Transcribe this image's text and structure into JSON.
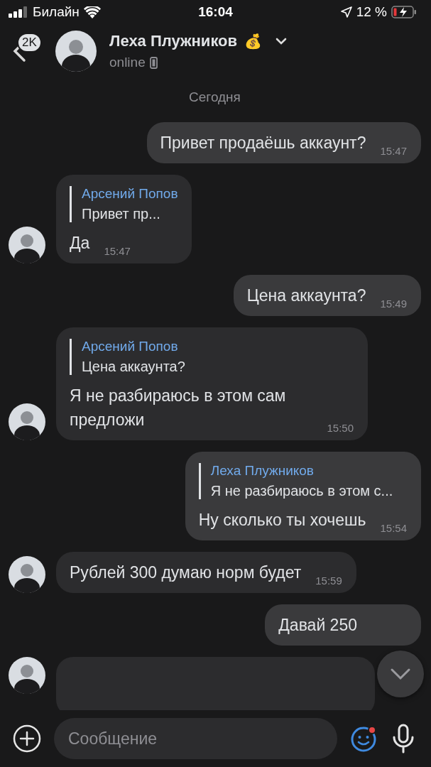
{
  "status_bar": {
    "carrier": "Билайн",
    "time": "16:04",
    "battery": "12 %"
  },
  "header": {
    "back_badge": "2K",
    "name": "Леха Плужников",
    "emoji": "💰",
    "status": "online"
  },
  "date_divider": "Сегодня",
  "messages": [
    {
      "kind": "out",
      "text": "Привет продаёшь аккаунт?",
      "time": "15:47"
    },
    {
      "kind": "in",
      "reply": {
        "author": "Арсений Попов",
        "text": "Привет пр..."
      },
      "text": "Да",
      "time": "15:47"
    },
    {
      "kind": "out",
      "text": "Цена аккаунта?",
      "time": "15:49"
    },
    {
      "kind": "in",
      "reply": {
        "author": "Арсений Попов",
        "text": "Цена аккаунта?"
      },
      "text": "Я не разбираюсь в этом сам предложи",
      "time": "15:50"
    },
    {
      "kind": "out",
      "reply": {
        "author": "Леха Плужников",
        "text": "Я не разбираюсь в этом с..."
      },
      "text": "Ну сколько ты хочешь",
      "time": "15:54"
    },
    {
      "kind": "in",
      "text": "Рублей 300 думаю норм будет",
      "time": "15:59"
    },
    {
      "kind": "out",
      "text": "Давай 250"
    },
    {
      "kind": "in"
    }
  ],
  "composer": {
    "placeholder": "Сообщение",
    "emoji_badge": true
  }
}
